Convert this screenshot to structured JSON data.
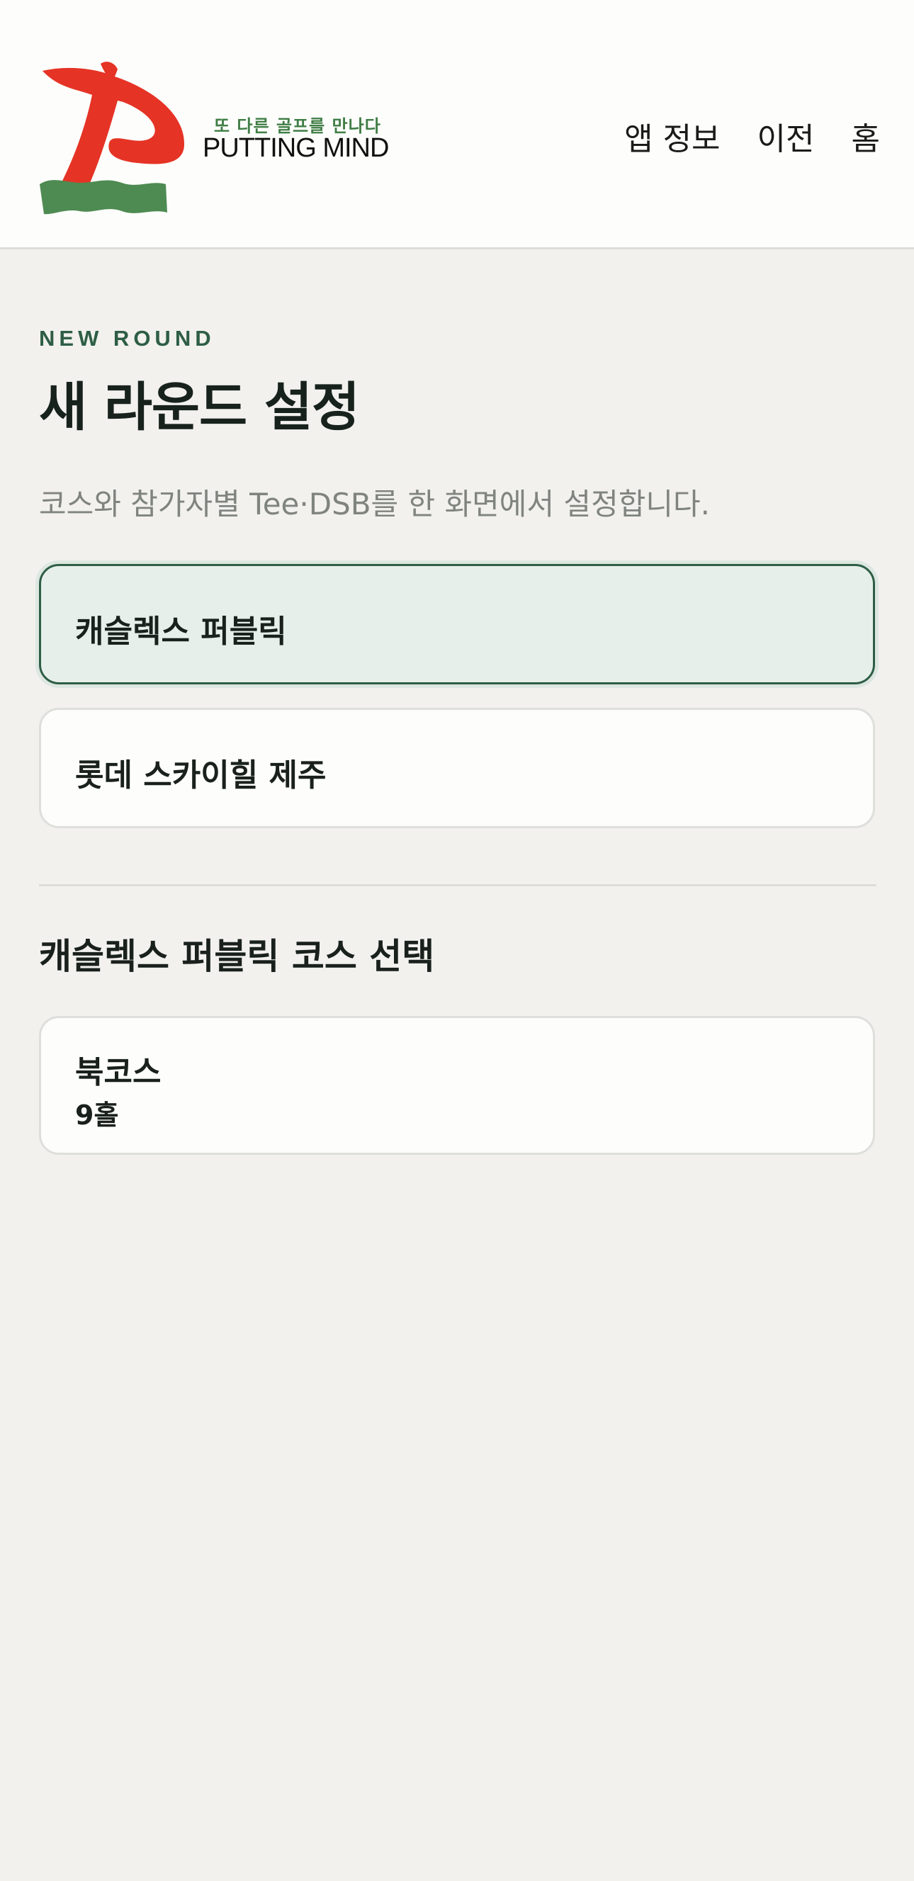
{
  "brand": {
    "tagline": "또 다른 골프를 만나다",
    "name": "PUTTING MIND",
    "colors": {
      "mark_red": "#e53325",
      "mark_green": "#4e8b52",
      "tagline_green": "#3f7d45"
    }
  },
  "nav": {
    "app_info": "앱 정보",
    "back": "이전",
    "home": "홈"
  },
  "page": {
    "eyebrow": "NEW ROUND",
    "title": "새 라운드 설정",
    "subtitle": "코스와 참가자별 Tee·DSB를 한 화면에서 설정합니다."
  },
  "clubs": [
    {
      "name": "캐슬렉스 퍼블릭",
      "selected": true
    },
    {
      "name": "롯데 스카이힐 제주",
      "selected": false
    }
  ],
  "course_section": {
    "title": "캐슬렉스 퍼블릭 코스 선택",
    "courses": [
      {
        "name": "북코스",
        "holes": "9홀"
      }
    ]
  },
  "colors": {
    "accent": "#2e5e45",
    "selected_bg": "#e6efea",
    "page_bg": "#f2f1ee",
    "header_bg": "#fdfdfb"
  }
}
